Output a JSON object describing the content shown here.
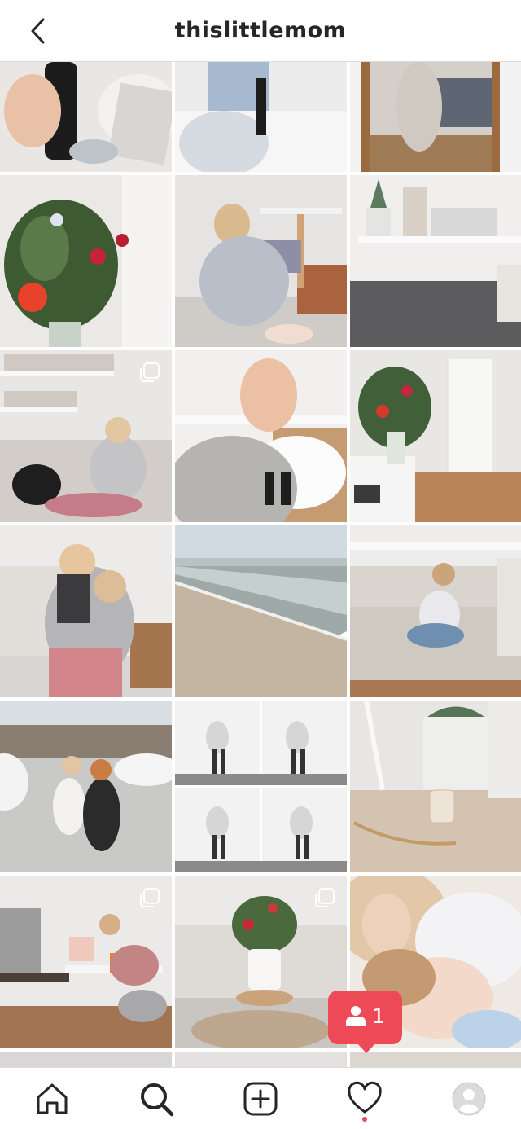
{
  "header": {
    "username": "thislittlemom"
  },
  "activity_bubble": {
    "follower_count": "1"
  },
  "nav": {
    "has_new_activity": true
  }
}
